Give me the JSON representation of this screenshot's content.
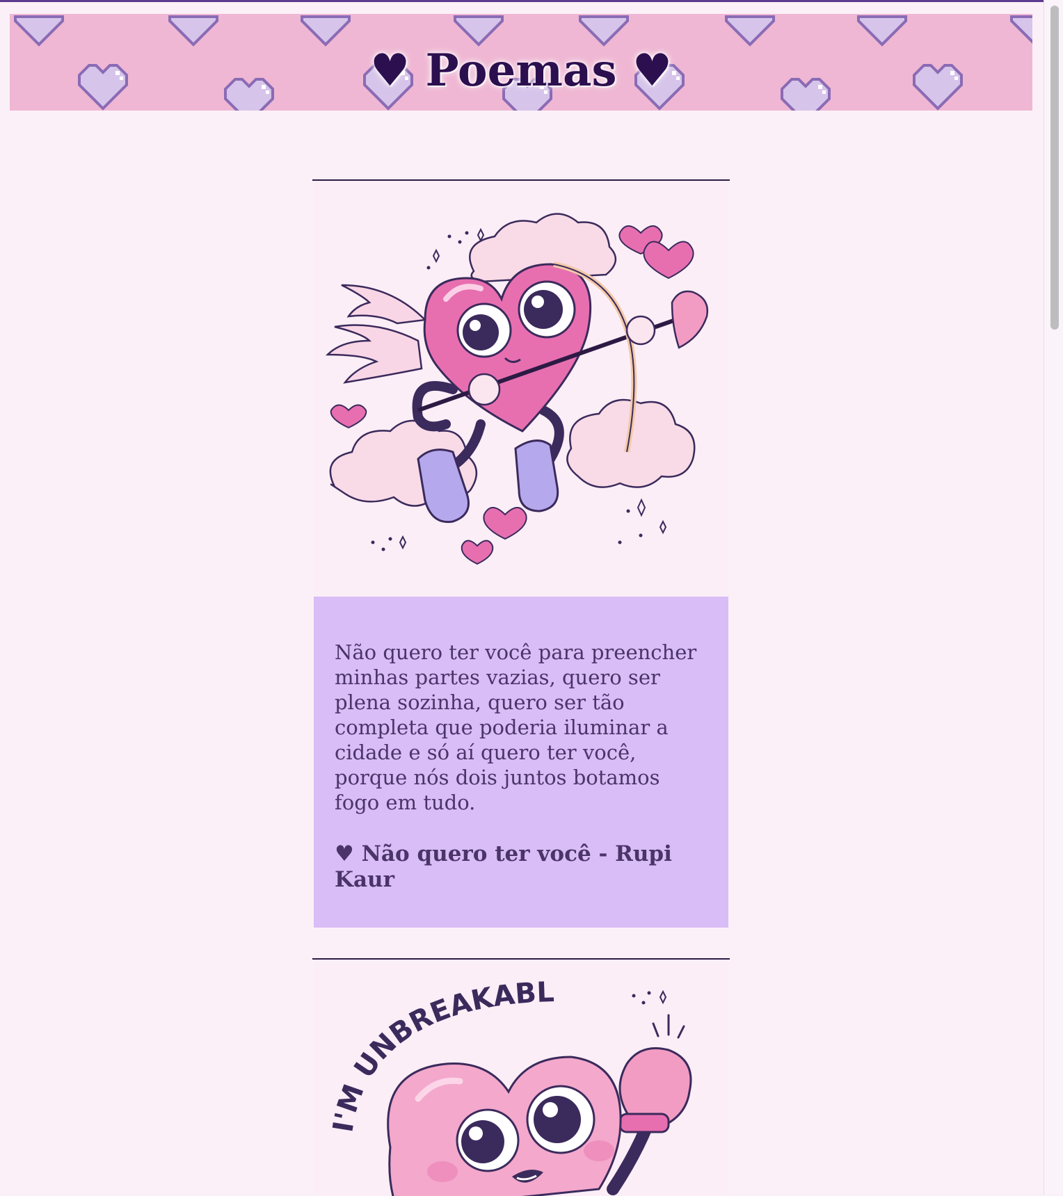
{
  "header": {
    "title": "♥ Poemas ♥"
  },
  "posts": [
    {
      "illustration": "cupid-heart-illustration",
      "text": "Não quero ter você para preencher minhas partes vazias, quero ser plena sozinha, quero ser tão completa que poderia iluminar a cidade e só aí quero ter você, porque nós dois juntos botamos fogo em tudo.",
      "source": "♥ Não quero ter você - Rupi Kaur"
    },
    {
      "illustration": "boxing-heart-illustration",
      "caption": "I'M UNBREAKABLE!"
    }
  ],
  "colors": {
    "background": "#fcf0f8",
    "banner": "#efb7d3",
    "banner_hearts": "#d7c4ea",
    "title": "#2c0f4f",
    "poem_box": "#d9bdf6",
    "poem_text": "#4a3468",
    "heart_pink": "#e76fb0",
    "outline": "#3b2a5c"
  }
}
